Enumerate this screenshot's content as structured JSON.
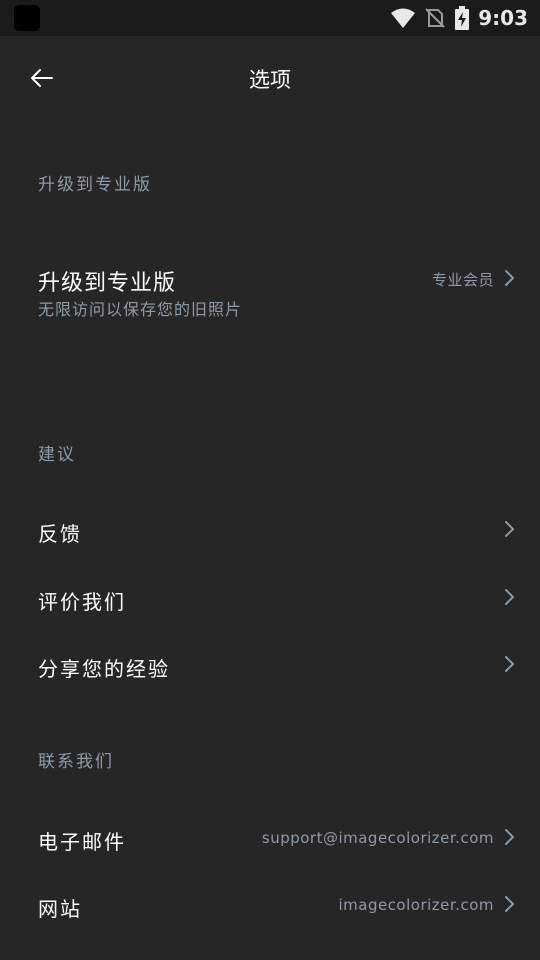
{
  "status_bar": {
    "time": "9:03",
    "icons": [
      "app-icon",
      "wifi-icon",
      "no-sim-icon",
      "battery-charging-icon"
    ]
  },
  "app_bar": {
    "title": "选项",
    "back_icon": "arrow-left-icon"
  },
  "sections": {
    "upgrade": {
      "header": "升级到专业版",
      "item": {
        "title": "升级到专业版",
        "subtitle": "无限访问以保存您的旧照片",
        "value": "专业会员"
      }
    },
    "suggestions": {
      "header": "建议",
      "items": [
        {
          "title": "反馈"
        },
        {
          "title": "评价我们"
        },
        {
          "title": "分享您的经验"
        }
      ]
    },
    "contact": {
      "header": "联系我们",
      "items": [
        {
          "title": "电子邮件",
          "value": "support@imagecolorizer.com"
        },
        {
          "title": "网站",
          "value": "imagecolorizer.com"
        }
      ]
    }
  },
  "colors": {
    "background": "#262626",
    "status_bar": "#1b1b1b",
    "secondary_text": "#8e9aa8",
    "primary_text": "#ffffff"
  }
}
